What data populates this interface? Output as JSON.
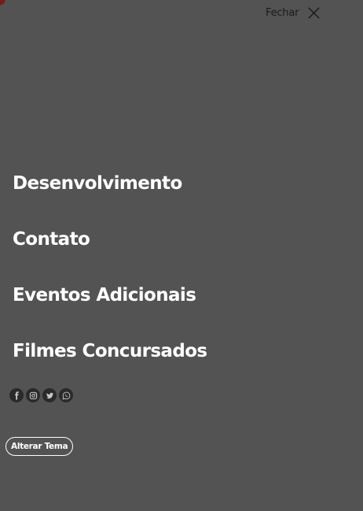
{
  "header": {
    "close_label": "Fechar",
    "close_icon": "close-icon"
  },
  "menu": {
    "items": [
      {
        "label": "Desenvolvimento"
      },
      {
        "label": "Contato"
      },
      {
        "label": "Eventos Adicionais"
      },
      {
        "label": "Filmes Concursados"
      }
    ]
  },
  "social": {
    "icons": [
      "facebook-icon",
      "instagram-icon",
      "twitter-icon",
      "whatsapp-icon"
    ]
  },
  "theme": {
    "button_label": "Alterar Tema"
  },
  "colors": {
    "background": "#545354",
    "text": "#ffffff",
    "icon_bg": "#2a2a2a",
    "accent": "#7a1a1a"
  }
}
